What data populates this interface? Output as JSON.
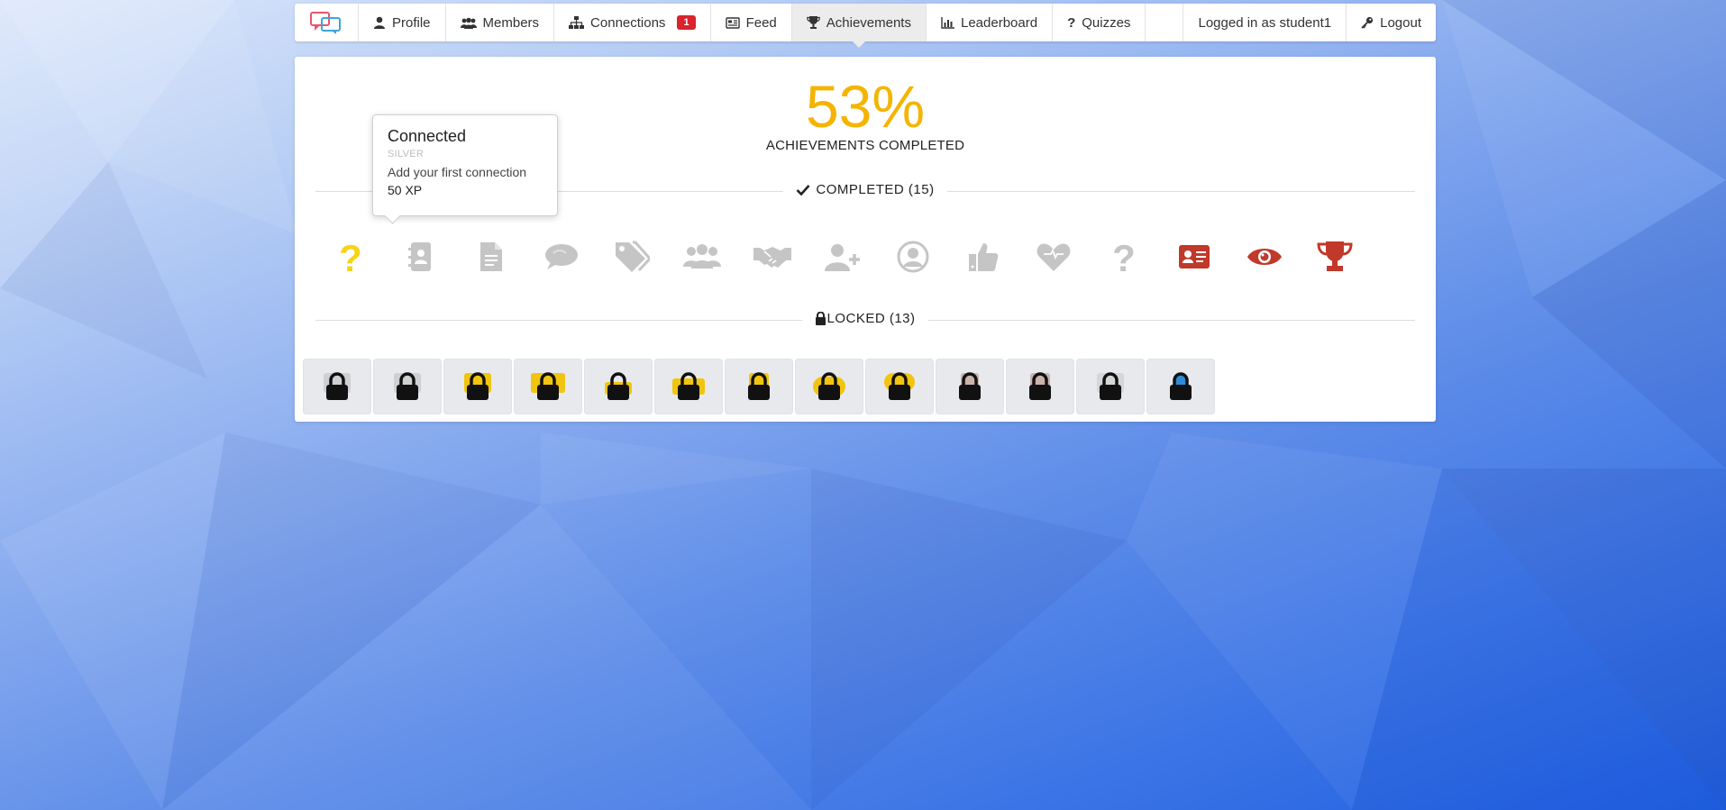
{
  "nav": {
    "profile": "Profile",
    "members": "Members",
    "connections": "Connections",
    "connections_badge": "1",
    "feed": "Feed",
    "achievements": "Achievements",
    "leaderboard": "Leaderboard",
    "quizzes": "Quizzes",
    "logged_in": "Logged in as student1",
    "logout": "Logout"
  },
  "summary": {
    "percent": "53%",
    "label": "ACHIEVEMENTS COMPLETED"
  },
  "completed": {
    "title": "COMPLETED (15)",
    "icons": [
      "question-icon",
      "contact-book-icon",
      "document-icon",
      "speech-bubble-icon",
      "tags-icon",
      "group-icon",
      "handshake-icon",
      "add-user-icon",
      "user-circle-icon",
      "thumbs-up-icon",
      "heart-icon",
      "question-icon",
      "id-card-icon",
      "eye-icon",
      "trophy-icon"
    ]
  },
  "locked": {
    "title": "LOCKED (13)",
    "count": 13
  },
  "tooltip": {
    "title": "Connected",
    "tier": "SILVER",
    "description": "Add your first connection",
    "xp": "50 XP"
  },
  "colors": {
    "accent": "#f5b400",
    "badge": "#d9232d",
    "red_icon": "#c0392b",
    "gray_icon": "#c5c5c5"
  }
}
